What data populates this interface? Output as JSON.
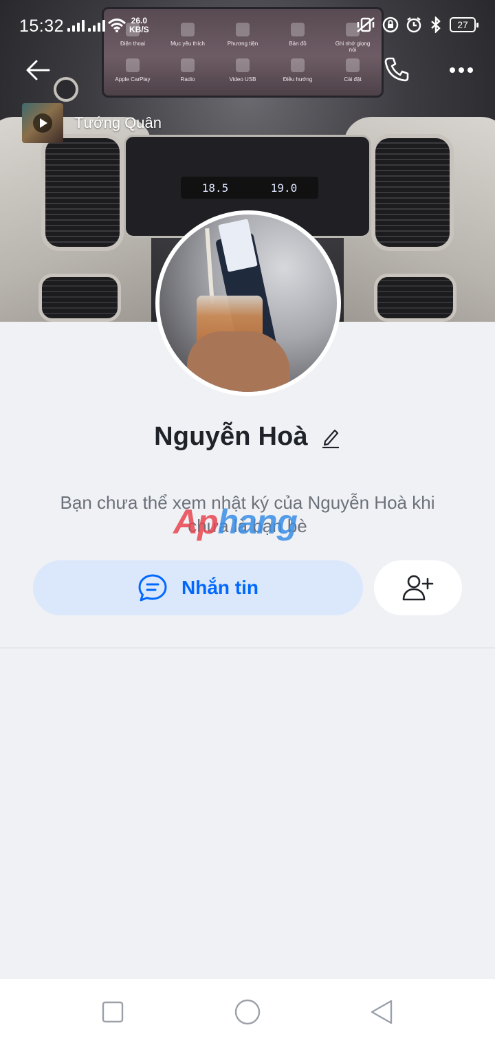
{
  "status_bar": {
    "time": "15:32",
    "net_speed_value": "26.0",
    "net_speed_unit": "KB/S",
    "battery": "27"
  },
  "header": {
    "back_icon": "arrow-left-icon",
    "call_icon": "phone-icon",
    "more_icon": "more-dots-icon"
  },
  "music": {
    "title": "Tướng Quân",
    "icon": "play-icon"
  },
  "cover_screen": {
    "apps_row1": [
      "Điện thoại",
      "Mục yêu thích",
      "Phương tiện",
      "Bản đồ",
      "Ghi nhớ giọng nói"
    ],
    "apps_row2": [
      "Apple CarPlay",
      "Radio",
      "Video USB",
      "Điều hướng",
      "Cài đặt"
    ],
    "climate_left": "18.5",
    "climate_right": "19.0"
  },
  "profile": {
    "name": "Nguyễn Hoà",
    "edit_icon": "pencil-icon",
    "notice": "Bạn chưa thể xem nhật ký của Nguyễn Hoà khi chưa là bạn bè",
    "watermark_a": "Ap",
    "watermark_b": "hang"
  },
  "actions": {
    "message_label": "Nhắn tin",
    "message_icon": "chat-bubble-icon",
    "add_friend_icon": "add-user-icon"
  },
  "colors": {
    "accent": "#0068ff",
    "accent_bg": "#dbe8fc",
    "page_bg": "#eff1f5"
  },
  "navbar": {
    "recent_icon": "square-icon",
    "home_icon": "circle-icon",
    "back_icon": "triangle-back-icon"
  }
}
